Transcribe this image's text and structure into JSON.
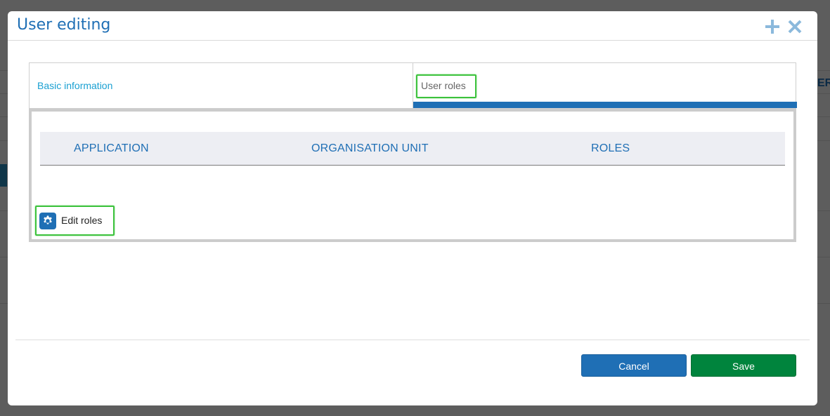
{
  "background": {
    "partial_text": "ER"
  },
  "modal": {
    "title": "User editing",
    "header_icons": [
      "plus-icon",
      "close-icon"
    ]
  },
  "tabs": [
    {
      "label": "Basic information",
      "active": false
    },
    {
      "label": "User roles",
      "active": true
    }
  ],
  "roles_table": {
    "columns": [
      "APPLICATION",
      "ORGANISATION UNIT",
      "ROLES"
    ],
    "rows": []
  },
  "edit_roles": {
    "label": "Edit roles",
    "icon": "gear-icon"
  },
  "footer": {
    "cancel_label": "Cancel",
    "save_label": "Save"
  },
  "colors": {
    "accent_blue": "#1f6fb5",
    "link_blue": "#1aa0d2",
    "save_green": "#00843d",
    "highlight_green": "#3cc23c"
  }
}
